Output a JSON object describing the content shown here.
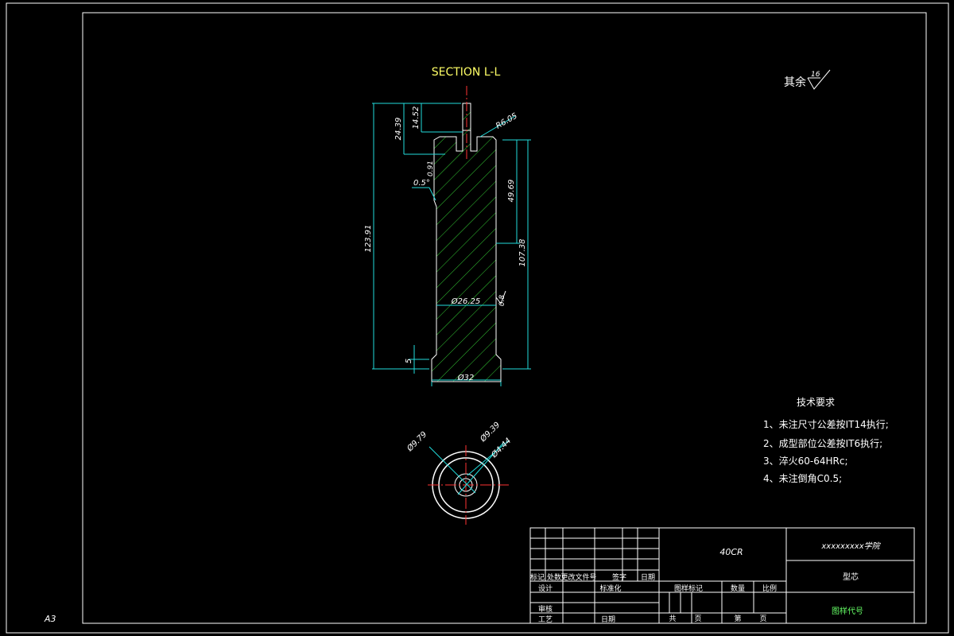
{
  "sheet": {
    "size_label": "A3"
  },
  "section_title": "SECTION L-L",
  "surface_finish": {
    "prefix": "其余",
    "value": "16"
  },
  "dimensions": {
    "overall_length": "123.91",
    "upper_step": "24.39",
    "neck_height": "14.52",
    "fillet_radius": "R6.05",
    "small_len": "0.91",
    "draft_angle": "0.5°",
    "upper_body": "49.69",
    "body_length": "107.38",
    "body_diameter": "Ø26.25",
    "surface_roughness": "0.8",
    "flange_height": "5",
    "flange_diameter": "Ø32",
    "top_outer": "Ø9.79",
    "top_mid": "Ø9.39",
    "top_inner": "Ø4.44"
  },
  "tech_requirements": {
    "title": "技术要求",
    "items": [
      "1、未注尺寸公差按IT14执行;",
      "2、成型部位公差按IT6执行;",
      "3、淬火60-64HRc;",
      "4、未注倒角C0.5;"
    ]
  },
  "title_block": {
    "material": "40CR",
    "school": "xxxxxxxxx学院",
    "part_name": "型芯",
    "drawing_code": "图样代号",
    "header_labels": [
      "标记",
      "处数",
      "更改文件号",
      "签字",
      "日期"
    ],
    "design": "设计",
    "standardize": "标准化",
    "review": "审核",
    "process": "工艺",
    "date": "日期",
    "stage_mark": "图样标记",
    "weight": "数量",
    "scale": "比例",
    "total": "共",
    "page": "页",
    "sheet_no": "第",
    "page2": "页"
  }
}
